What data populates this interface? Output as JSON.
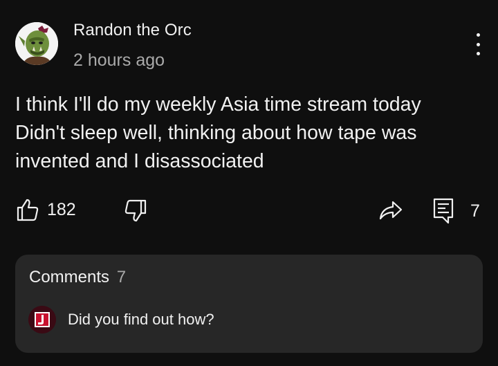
{
  "post": {
    "author": "Randon the Orc",
    "time_ago": "2 hours ago",
    "avatar_icon": "orc-avatar",
    "text_lines": [
      "I think I'll do my weekly Asia time stream today",
      "Didn't sleep well, thinking about how tape was",
      "invented and I disassociated"
    ]
  },
  "actions": {
    "like_count": "182",
    "reply_count": "7",
    "icons": [
      "thumbs-up-icon",
      "thumbs-down-icon",
      "share-icon",
      "comment-icon",
      "more-vert-icon"
    ]
  },
  "comments": {
    "title": "Comments",
    "count": "7",
    "top_comment": {
      "text": "Did you find out how?",
      "avatar_icon": "letter-j-avatar"
    }
  },
  "colors": {
    "background": "#0f0f0f",
    "card": "#272727",
    "text_primary": "#f1f1f1",
    "text_secondary": "#aaaaaa",
    "avatar_red": "#c8102e"
  }
}
